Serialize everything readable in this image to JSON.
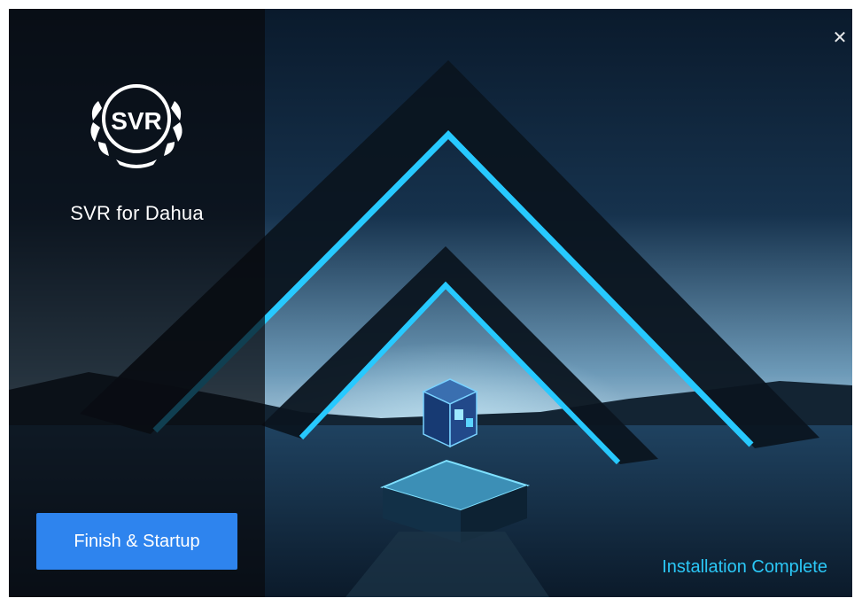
{
  "window": {
    "app_name": "SVR for Dahua",
    "close_icon": "close-icon"
  },
  "logo": {
    "text": "SVR",
    "icon": "laurel-wreath-logo"
  },
  "actions": {
    "finish_label": "Finish & Startup"
  },
  "status": {
    "text": "Installation Complete"
  },
  "colors": {
    "accent": "#2e84ee",
    "status": "#2bc7f6",
    "neon": "#27c9ff"
  }
}
